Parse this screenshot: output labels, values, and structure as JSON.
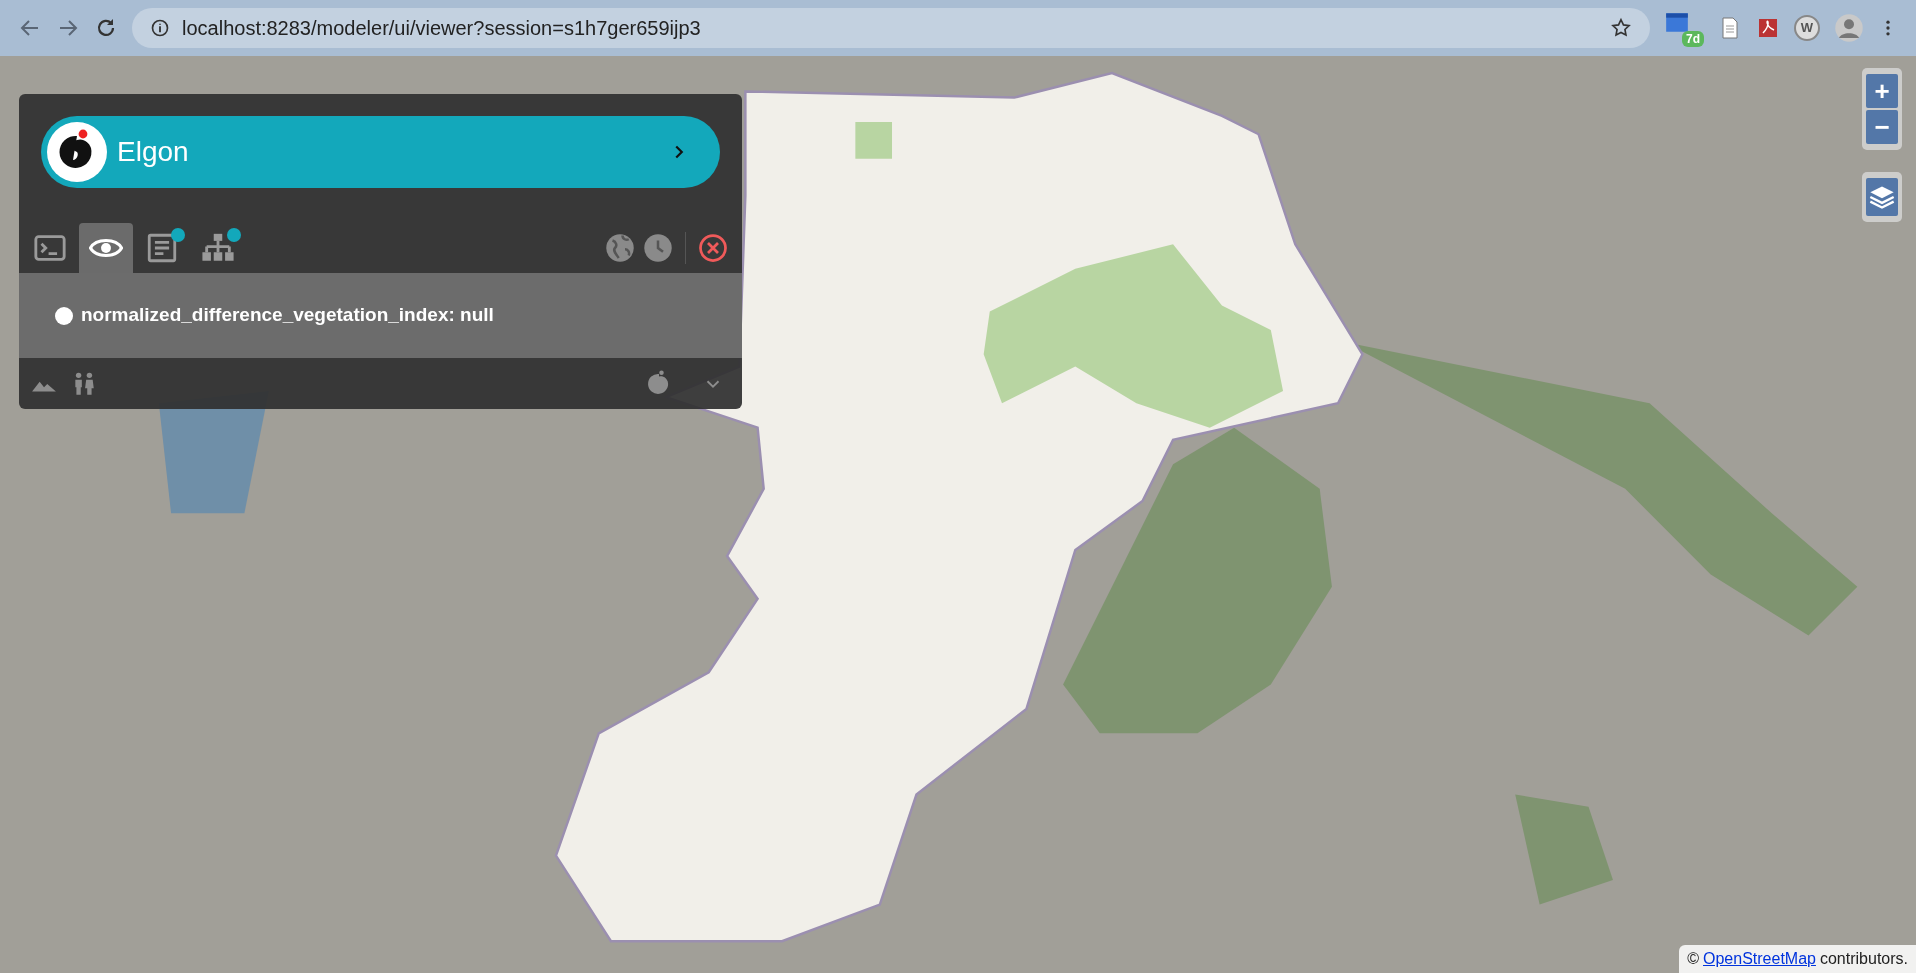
{
  "browser": {
    "url": "localhost:8283/modeler/ui/viewer?session=s1h7ger659ijp3",
    "extension_badge": "7d",
    "extension_letter": "W"
  },
  "panel": {
    "title": "Elgon",
    "tabs": [
      {
        "kind": "console",
        "selected": false,
        "notification": false
      },
      {
        "kind": "viewer",
        "selected": true,
        "notification": false
      },
      {
        "kind": "report",
        "selected": false,
        "notification": true
      },
      {
        "kind": "tree",
        "selected": false,
        "notification": true
      }
    ],
    "observation": "normalized_difference_vegetation_index: null"
  },
  "map_controls": {
    "zoom_in": "+",
    "zoom_out": "−"
  },
  "attribution": {
    "prefix": "©",
    "link": "OpenStreetMap",
    "suffix": "contributors."
  }
}
